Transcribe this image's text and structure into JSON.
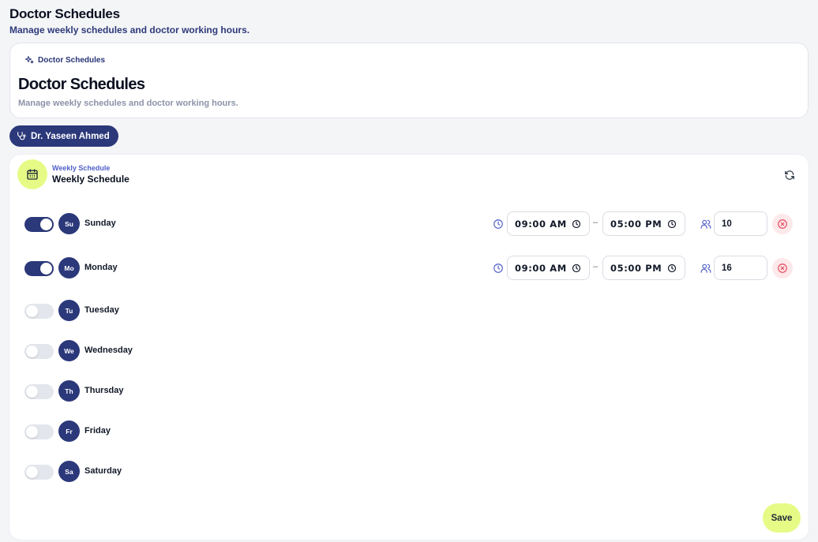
{
  "page": {
    "title": "Doctor Schedules",
    "subtitle": "Manage weekly schedules and doctor working hours."
  },
  "hero": {
    "crumb_icon": "sparkles-icon",
    "crumb_label": "Doctor Schedules",
    "title": "Doctor Schedules",
    "subtitle": "Manage weekly schedules and doctor working hours."
  },
  "doctor_chip": {
    "icon": "stethoscope-icon",
    "label": "Dr. Yaseen Ahmed"
  },
  "schedule": {
    "icon": "calendar-icon",
    "eyebrow": "Weekly Schedule",
    "title": "Weekly Schedule",
    "refresh_icon": "refresh-icon",
    "days": [
      {
        "abbr": "Su",
        "name": "Sunday",
        "enabled": true,
        "start": "09:00 AM",
        "end": "05:00 PM",
        "capacity": "10"
      },
      {
        "abbr": "Mo",
        "name": "Monday",
        "enabled": true,
        "start": "09:00 AM",
        "end": "05:00 PM",
        "capacity": "16"
      },
      {
        "abbr": "Tu",
        "name": "Tuesday",
        "enabled": false
      },
      {
        "abbr": "We",
        "name": "Wednesday",
        "enabled": false
      },
      {
        "abbr": "Th",
        "name": "Thursday",
        "enabled": false
      },
      {
        "abbr": "Fr",
        "name": "Friday",
        "enabled": false
      },
      {
        "abbr": "Sa",
        "name": "Saturday",
        "enabled": false
      }
    ],
    "time_separator": "–",
    "save_label": "Save"
  },
  "colors": {
    "primary": "#2b387a",
    "accent": "#e6fb86",
    "danger": "#e5485d",
    "muted": "#8c93a8"
  }
}
